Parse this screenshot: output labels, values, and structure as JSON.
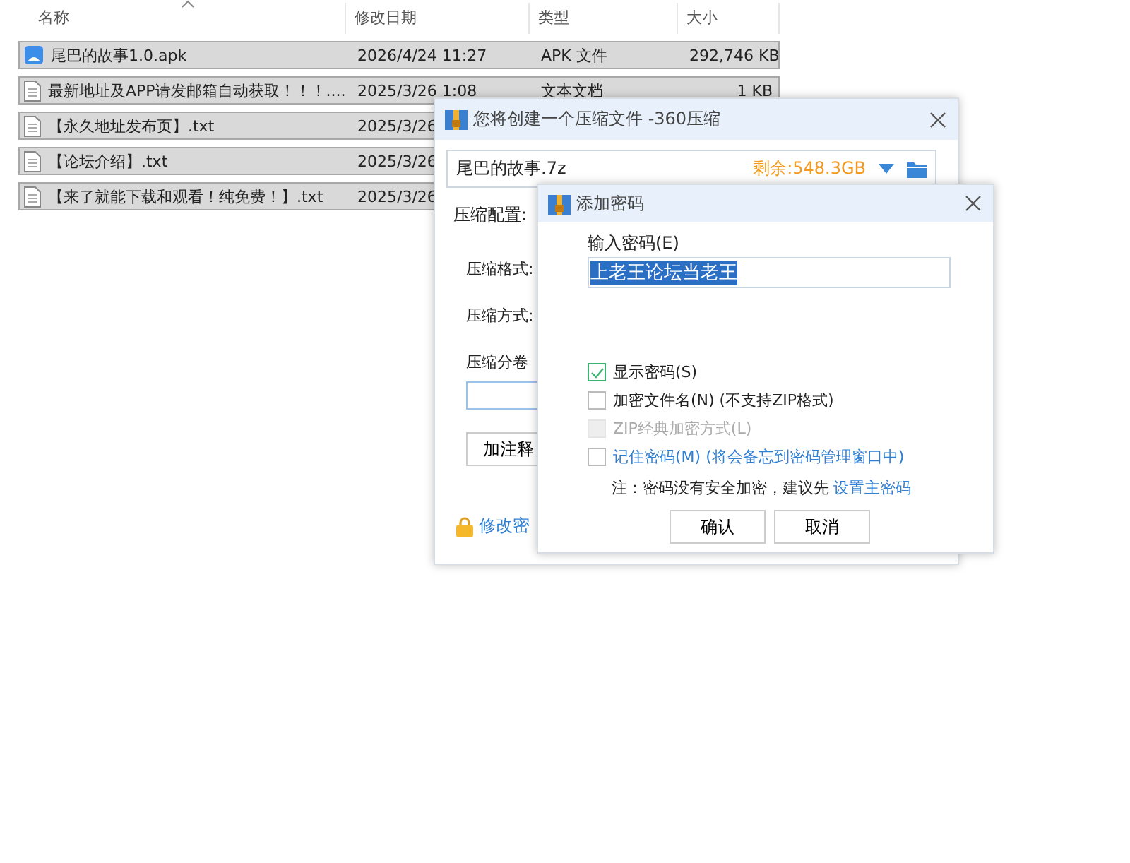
{
  "file_list": {
    "columns": [
      "名称",
      "修改日期",
      "类型",
      "大小"
    ],
    "rows": [
      {
        "kind": "apk",
        "selected": true,
        "name": "尾巴的故事1.0.apk",
        "modified": "2026/4/24 11:27",
        "type": "APK 文件",
        "size": "292,746 KB"
      },
      {
        "kind": "text",
        "selected": true,
        "name": "最新地址及APP请发邮箱自动获取！！！....",
        "modified": "2025/3/26 1:08",
        "type": "文本文档",
        "size": "1 KB"
      },
      {
        "kind": "text",
        "selected": true,
        "name": "【永久地址发布页】.txt",
        "modified": "2025/3/26"
      },
      {
        "kind": "text",
        "selected": true,
        "name": "【论坛介绍】.txt",
        "modified": "2025/3/26"
      },
      {
        "kind": "text",
        "selected": true,
        "name": "【来了就能下载和观看！纯免费！】.txt",
        "modified": "2025/3/26"
      }
    ]
  },
  "compress_dialog": {
    "title": "您将创建一个压缩文件 -360压缩",
    "filename": "尾巴的故事.7z",
    "free_space": "剩余:548.3GB",
    "config_label": "压缩配置:",
    "format_label": "压缩格式:",
    "method_label": "压缩方式:",
    "split_label": "压缩分卷",
    "comment_button": "加注释",
    "change_password_link": "修改密"
  },
  "password_dialog": {
    "title": "添加密码",
    "password_label": "输入密码(E)",
    "password_value": "上老王论坛当老王",
    "value_selected": true,
    "options": [
      {
        "kind": "plain",
        "label": "显示密码(S)",
        "checked": true,
        "disabled": false
      },
      {
        "kind": "plain",
        "label": "加密文件名(N) (不支持ZIP格式)",
        "checked": false,
        "disabled": false
      },
      {
        "kind": "plain",
        "label": "ZIP经典加密方式(L)",
        "checked": false,
        "disabled": true
      },
      {
        "kind": "link",
        "label": "记住密码(M) (将会备忘到密码管理窗口中)",
        "checked": false,
        "disabled": false
      }
    ],
    "note": "注：密码没有安全加密，建议先",
    "note_link": "设置主密码",
    "buttons": [
      "确认",
      "取消"
    ]
  }
}
